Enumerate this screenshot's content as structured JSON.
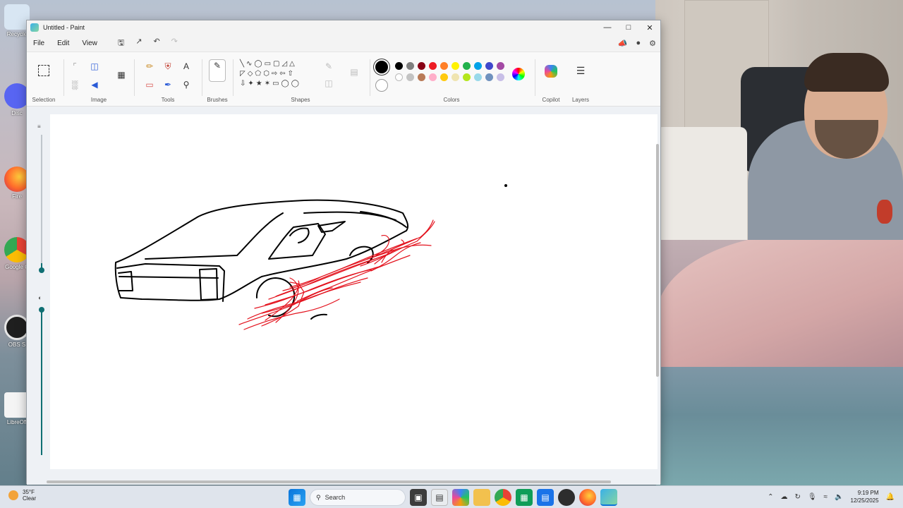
{
  "window": {
    "title": "Untitled - Paint"
  },
  "menu": [
    "File",
    "Edit",
    "View"
  ],
  "ribbon_groups": {
    "selection": "Selection",
    "image": "Image",
    "tools": "Tools",
    "brushes": "Brushes",
    "shapes": "Shapes",
    "colors": "Colors",
    "copilot": "Copilot",
    "layers": "Layers"
  },
  "colors": {
    "primary": "#000000",
    "row1": [
      "#000000",
      "#7f7f7f",
      "#880015",
      "#ed1c24",
      "#ff7f27",
      "#fff200",
      "#22b14c",
      "#00a2e8",
      "#3f48cc",
      "#a349a4"
    ],
    "row2": [
      "#ffffff",
      "#c3c3c3",
      "#b97a57",
      "#ffaec9",
      "#ffc90e",
      "#efe4b0",
      "#b5e61d",
      "#99d9ea",
      "#7092be",
      "#c8bfe7"
    ]
  },
  "desktop_icons": [
    "Recycle",
    "Disc",
    "Fire",
    "Google C",
    "OBS S",
    "LibreOff"
  ],
  "taskbar": {
    "weather_temp": "35°F",
    "weather_desc": "Clear",
    "search_placeholder": "Search",
    "time": "9:19 PM",
    "date": "12/25/2025"
  }
}
